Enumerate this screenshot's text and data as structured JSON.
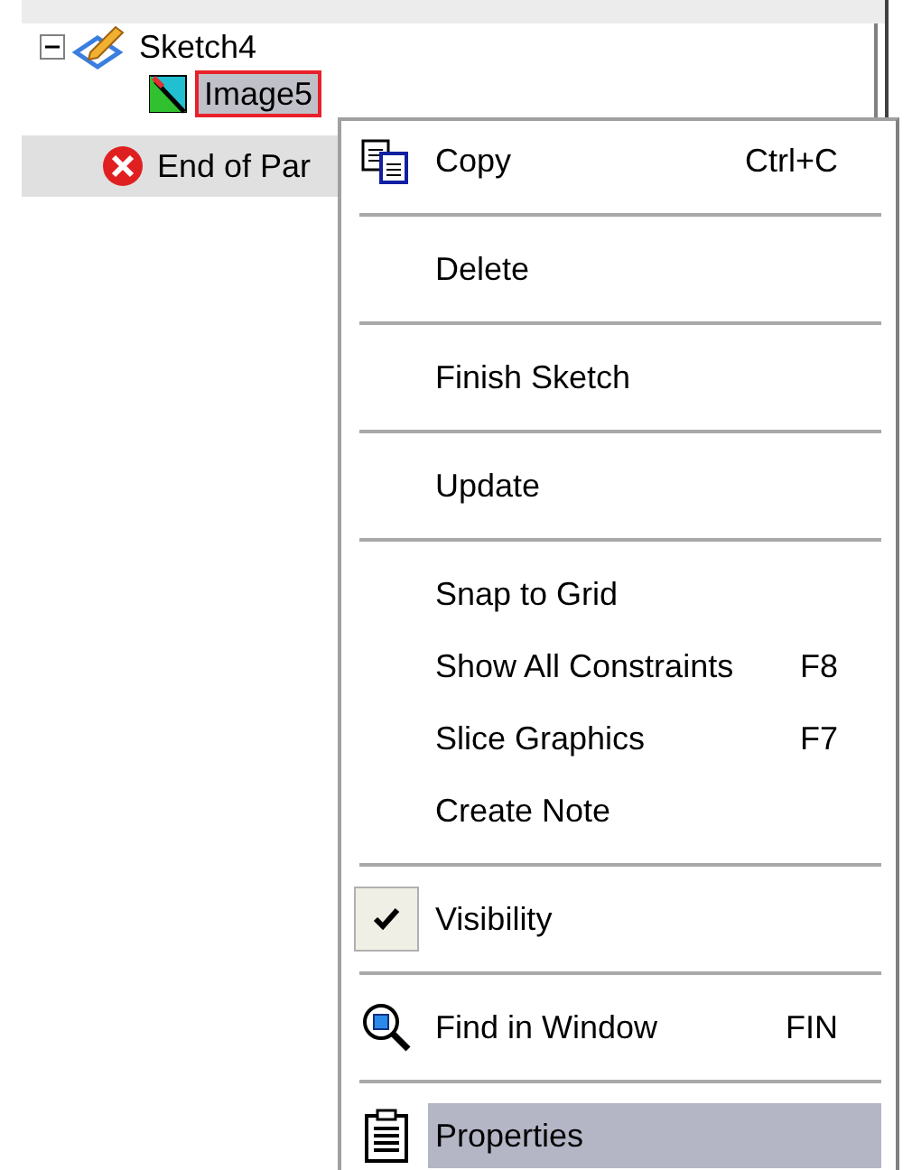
{
  "tree": {
    "items": [
      {
        "label": "Sketch4",
        "expanded": true,
        "selected": false,
        "children": [
          {
            "label": "Image5",
            "selected": true
          }
        ]
      },
      {
        "label": "End of Par",
        "selected": false
      }
    ]
  },
  "context_menu": {
    "items": [
      {
        "kind": "item",
        "label": "Copy",
        "shortcut": "Ctrl+C",
        "checked": false,
        "selected": false
      },
      {
        "kind": "separator"
      },
      {
        "kind": "item",
        "label": "Delete",
        "checked": false,
        "selected": false
      },
      {
        "kind": "separator"
      },
      {
        "kind": "item",
        "label": "Finish Sketch",
        "checked": false,
        "selected": false
      },
      {
        "kind": "separator"
      },
      {
        "kind": "item",
        "label": "Update",
        "checked": false,
        "selected": false
      },
      {
        "kind": "separator"
      },
      {
        "kind": "item",
        "label": "Snap to Grid",
        "checked": false,
        "selected": false
      },
      {
        "kind": "item",
        "label": "Show All Constraints",
        "shortcut": "F8",
        "checked": false,
        "selected": false
      },
      {
        "kind": "item",
        "label": "Slice Graphics",
        "shortcut": "F7",
        "checked": false,
        "selected": false
      },
      {
        "kind": "item",
        "label": "Create Note",
        "checked": false,
        "selected": false
      },
      {
        "kind": "separator"
      },
      {
        "kind": "item",
        "label": "Visibility",
        "checked": true,
        "selected": false
      },
      {
        "kind": "separator"
      },
      {
        "kind": "item",
        "label": "Find in Window",
        "shortcut": "FIN",
        "checked": false,
        "selected": false
      },
      {
        "kind": "separator"
      },
      {
        "kind": "item",
        "label": "Properties",
        "checked": false,
        "selected": true
      }
    ]
  }
}
